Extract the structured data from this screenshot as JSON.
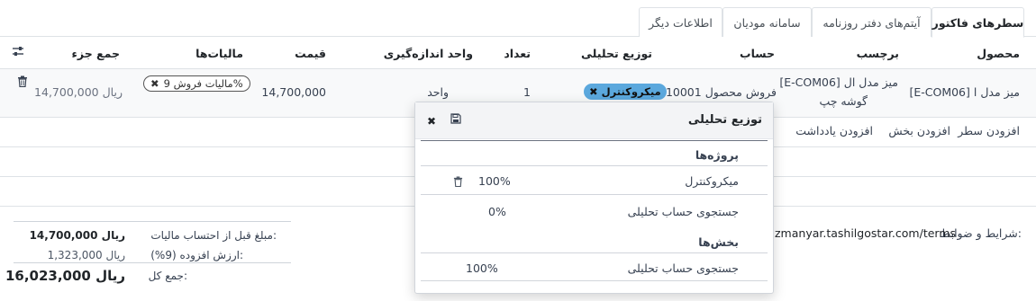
{
  "tabs": [
    {
      "label": "سطرهای فاکتور",
      "active": true
    },
    {
      "label": "آیتم‌های دفتر روزنامه",
      "active": false
    },
    {
      "label": "سامانه مودیان",
      "active": false
    },
    {
      "label": "اطلاعات دیگر",
      "active": false
    }
  ],
  "columns": {
    "product": "محصول",
    "label": "برچسب",
    "account": "حساب",
    "analytic": "توزیع تحلیلی",
    "quantity": "تعداد",
    "uom": "واحد اندازه‌گیری",
    "price": "قیمت",
    "taxes": "مالیات‌ها",
    "subtotal": "جمع جزء"
  },
  "line": {
    "product": "[E-COM06] میز مدل ا",
    "label_line1": "[E-COM06] میز مدل ال",
    "label_line2": "گوشه چپ",
    "account": "610001 فروش محصول",
    "analytic_tag": "میکروکنترل",
    "quantity": "1",
    "uom": "واحد",
    "price": "14,700,000",
    "tax_tag": "مالیات فروش 9%",
    "subtotal": "14,700,000 ریال"
  },
  "add_links": {
    "add_line": "افزودن سطر",
    "add_section": "افزودن بخش",
    "add_note": "افزودن یادداشت"
  },
  "terms": {
    "label": "شرایط و ضوابط:",
    "url": "zmanyar.tashilgostar.com/terms"
  },
  "totals": {
    "untaxed_label": "مبلغ قبل از احتساب مالیات:",
    "untaxed_value": "14,700,000 ریال",
    "vat_label": "ارزش افزوده (9%):",
    "vat_value": "1,323,000 ریال",
    "total_label": "جمع کل:",
    "total_value": "16,023,000 ریال"
  },
  "popover": {
    "title": "توزیع تحلیلی",
    "projects_heading": "پروژه‌ها",
    "project_row_name": "میکروکنترل",
    "project_row_pct": "100%",
    "project_search_placeholder": "جستجوی حساب تحلیلی",
    "project_search_pct": "0%",
    "sections_heading": "بخش‌ها",
    "section_search_placeholder": "جستجوی حساب تحلیلی",
    "section_search_pct": "100%"
  },
  "icons": {
    "column_settings": "sliders-icon",
    "delete": "trash-icon",
    "close": "close-icon",
    "save": "save-icon"
  },
  "colors": {
    "analytic_tag_bg": "#5ba8dd",
    "row_bg": "#f8f9fa",
    "popover_header_bg": "#f3f4f6"
  }
}
